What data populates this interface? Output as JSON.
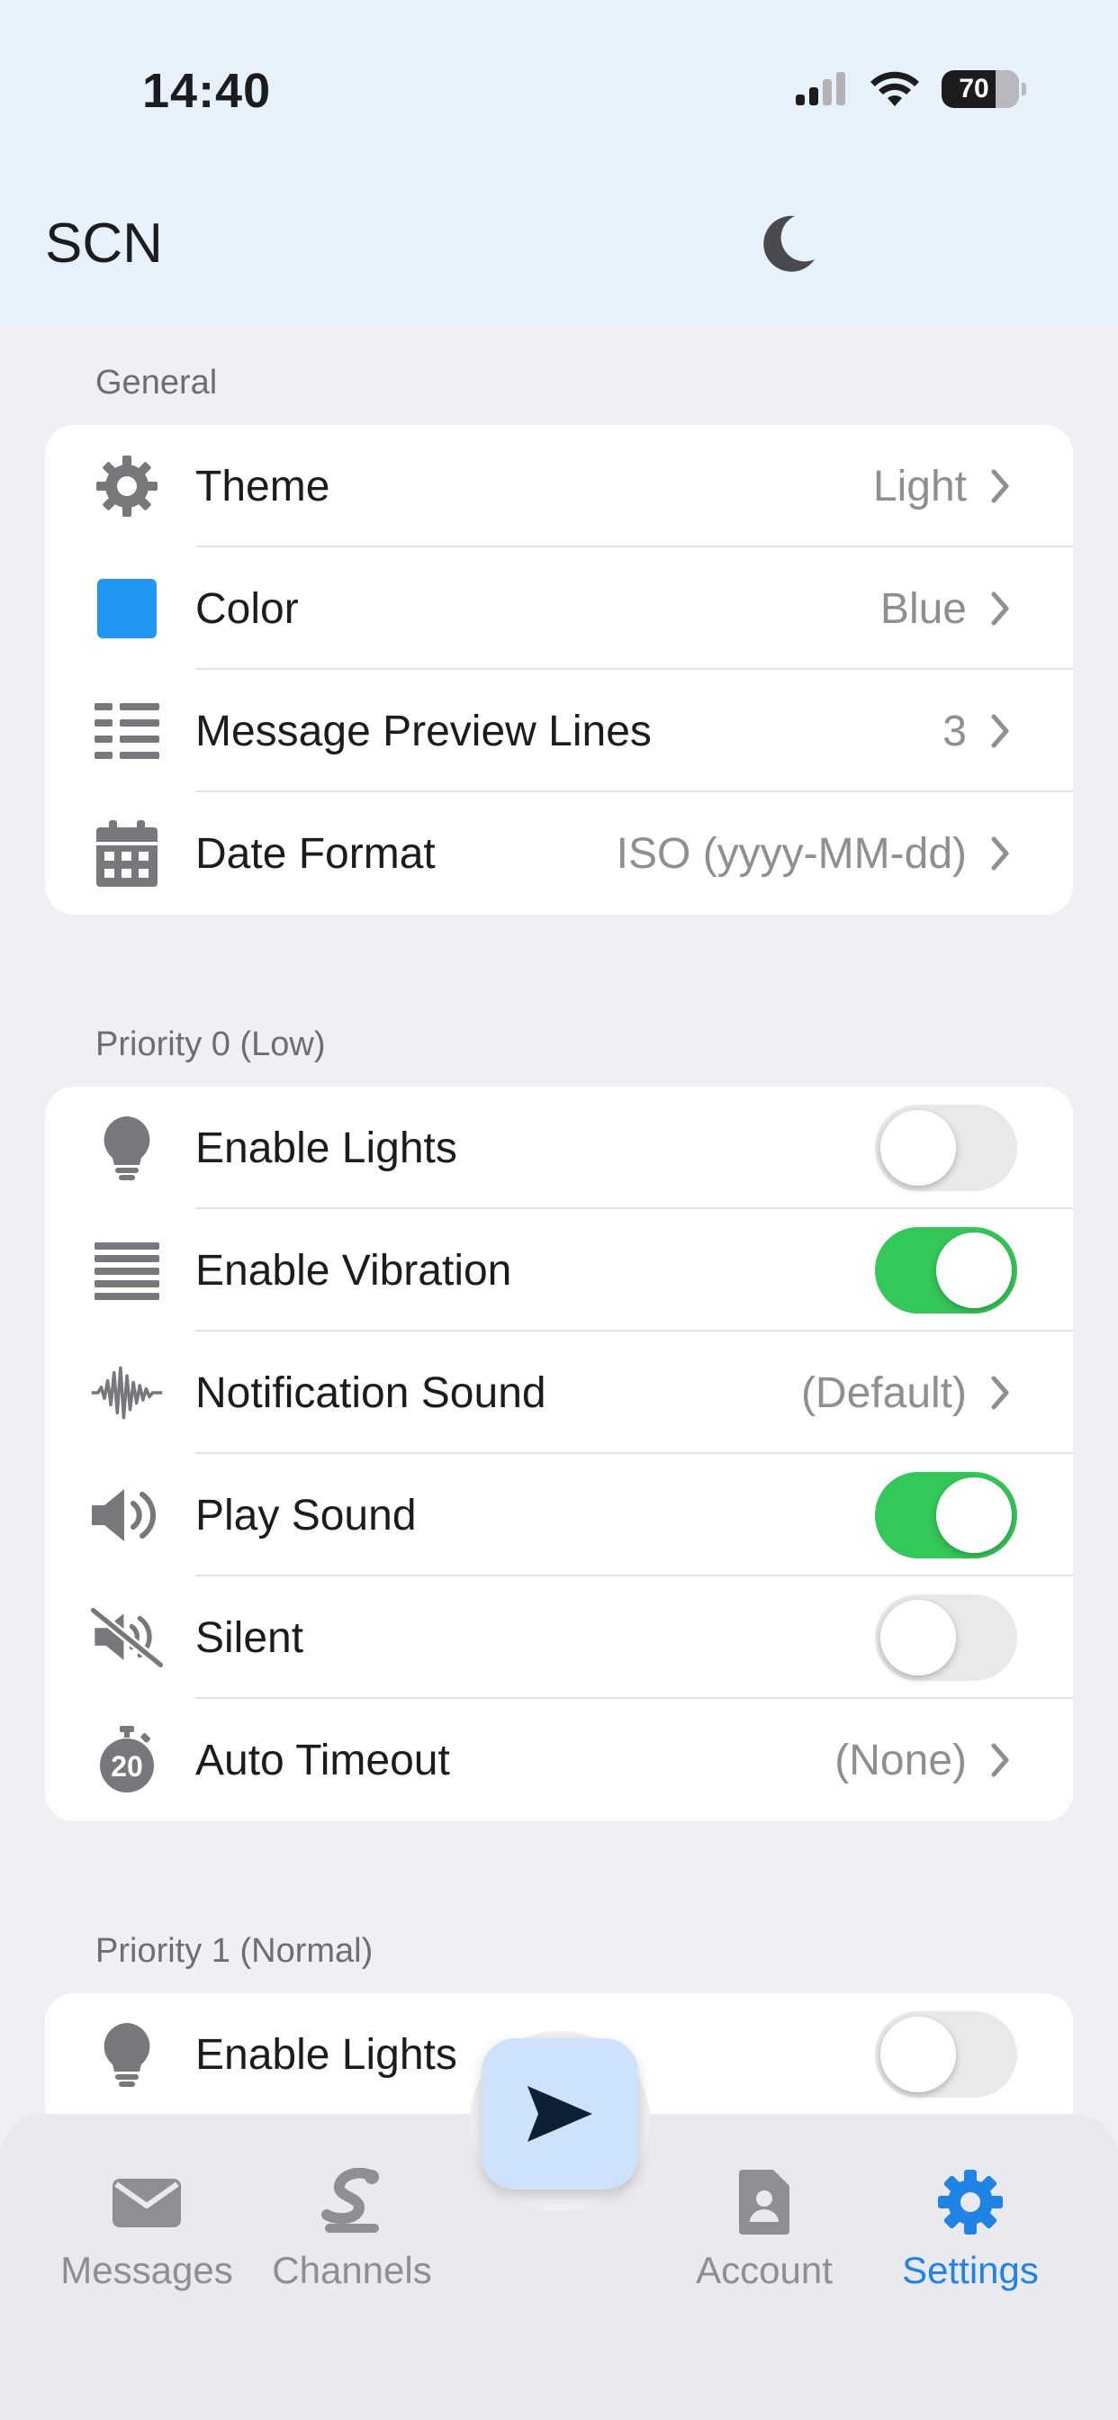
{
  "status_bar": {
    "time": "14:40",
    "battery": "70"
  },
  "header": {
    "title": "SCN"
  },
  "sections": [
    {
      "title": "General",
      "rows": [
        {
          "icon": "gear-icon",
          "label": "Theme",
          "value": "Light",
          "kind": "nav"
        },
        {
          "icon": "color-swatch-icon",
          "label": "Color",
          "value": "Blue",
          "kind": "nav"
        },
        {
          "icon": "lines-icon",
          "label": "Message Preview Lines",
          "value": "3",
          "kind": "nav"
        },
        {
          "icon": "calendar-icon",
          "label": "Date Format",
          "value": "ISO (yyyy-MM-dd)",
          "kind": "nav"
        }
      ]
    },
    {
      "title": "Priority 0 (Low)",
      "rows": [
        {
          "icon": "lightbulb-icon",
          "label": "Enable Lights",
          "kind": "toggle",
          "on": false
        },
        {
          "icon": "vibration-icon",
          "label": "Enable Vibration",
          "kind": "toggle",
          "on": true
        },
        {
          "icon": "waveform-icon",
          "label": "Notification Sound",
          "value": "(Default)",
          "kind": "nav"
        },
        {
          "icon": "speaker-icon",
          "label": "Play Sound",
          "kind": "toggle",
          "on": true
        },
        {
          "icon": "speaker-muted-icon",
          "label": "Silent",
          "kind": "toggle",
          "on": false
        },
        {
          "icon": "timer-icon",
          "label": "Auto Timeout",
          "value": "(None)",
          "kind": "nav"
        }
      ]
    },
    {
      "title": "Priority 1 (Normal)",
      "rows": [
        {
          "icon": "lightbulb-icon",
          "label": "Enable Lights",
          "kind": "toggle",
          "on": false
        }
      ]
    }
  ],
  "timer_icon_text": "20",
  "tabs": [
    {
      "label": "Messages",
      "icon": "envelope-icon",
      "active": false
    },
    {
      "label": "Channels",
      "icon": "channels-icon",
      "active": false
    },
    {
      "label": "Account",
      "icon": "account-icon",
      "active": false
    },
    {
      "label": "Settings",
      "icon": "settings-gear-icon",
      "active": true
    }
  ],
  "colors": {
    "accent": "#1f84e6",
    "toggle_on": "#34c759",
    "swatch_blue": "#2196f3",
    "header_bg": "#e6f1fb",
    "icon_gray": "#77777c"
  }
}
